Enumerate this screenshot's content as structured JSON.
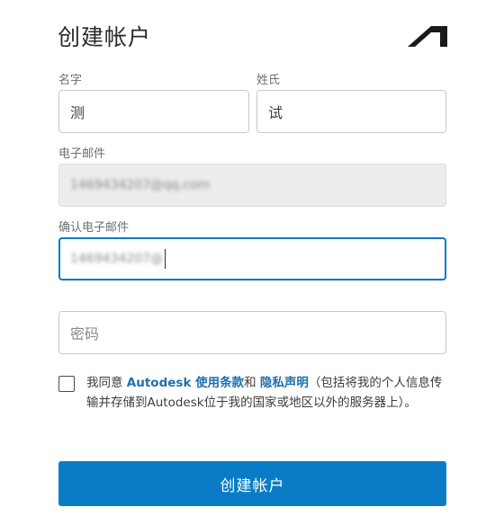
{
  "form": {
    "title": "创建帐户",
    "first_name_label": "名字",
    "first_name_value": "测",
    "last_name_label": "姓氏",
    "last_name_value": "试",
    "email_label": "电子邮件",
    "email_value": "1469434207@qq.com",
    "confirm_email_label": "确认电子邮件",
    "confirm_email_value": "1469434207@",
    "password_placeholder": "密码",
    "agree_prefix": "我同意 ",
    "agree_link_terms": "Autodesk 使用条款",
    "agree_and": "和 ",
    "agree_link_privacy": "隐私声明",
    "agree_suffix": "（包括将我的个人信息传输并存储到Autodesk位于我的国家或地区以外的服务器上）。",
    "submit_label": "创建帐户"
  },
  "colors": {
    "accent": "#0a7cc6",
    "link": "#1f6fb0",
    "focus_border": "#0a79c2"
  },
  "icons": {
    "logo": "autodesk-logo"
  }
}
